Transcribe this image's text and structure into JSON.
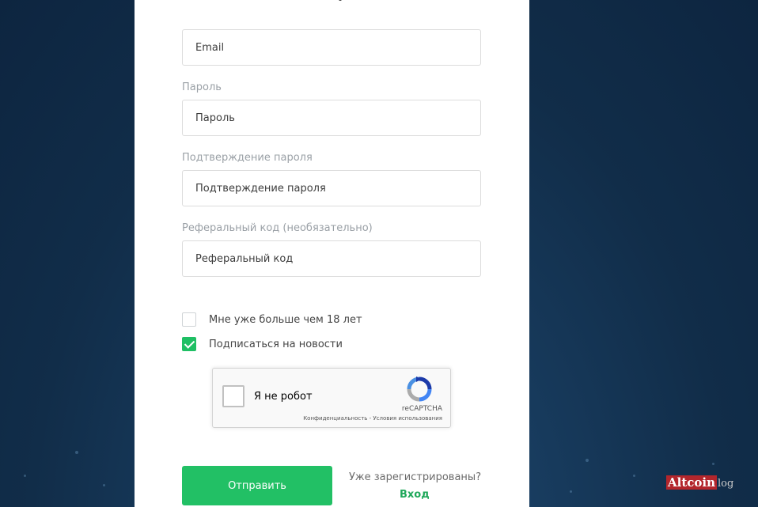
{
  "form": {
    "email": {
      "label": "",
      "placeholder": "Email"
    },
    "password": {
      "label": "Пароль",
      "placeholder": "Пароль"
    },
    "confirm": {
      "label": "Подтверждение пароля",
      "placeholder": "Подтверждение пароля"
    },
    "referral": {
      "label": "Реферальный код (необязательно)",
      "placeholder": "Реферальный код"
    }
  },
  "checkboxes": {
    "age": {
      "label": "Мне уже больше чем 18 лет",
      "checked": false
    },
    "news": {
      "label": "Подписаться на новости",
      "checked": true
    }
  },
  "recaptcha": {
    "label": "Я не робот",
    "brand": "reCAPTCHA",
    "privacy": "Конфиденциальность",
    "separator": " - ",
    "terms": "Условия использования"
  },
  "actions": {
    "submit_label": "Отправить",
    "already_registered": "Уже зарегистрированы?",
    "login_link": "Вход"
  },
  "watermark": {
    "part1": "Altcoin",
    "part2": "log"
  },
  "colors": {
    "accent": "#22c065",
    "background": "#143558",
    "watermark_red": "#b3262c"
  },
  "icons": {
    "recaptcha_logo": "recaptcha-logo-icon",
    "checkmark": "check-icon"
  }
}
